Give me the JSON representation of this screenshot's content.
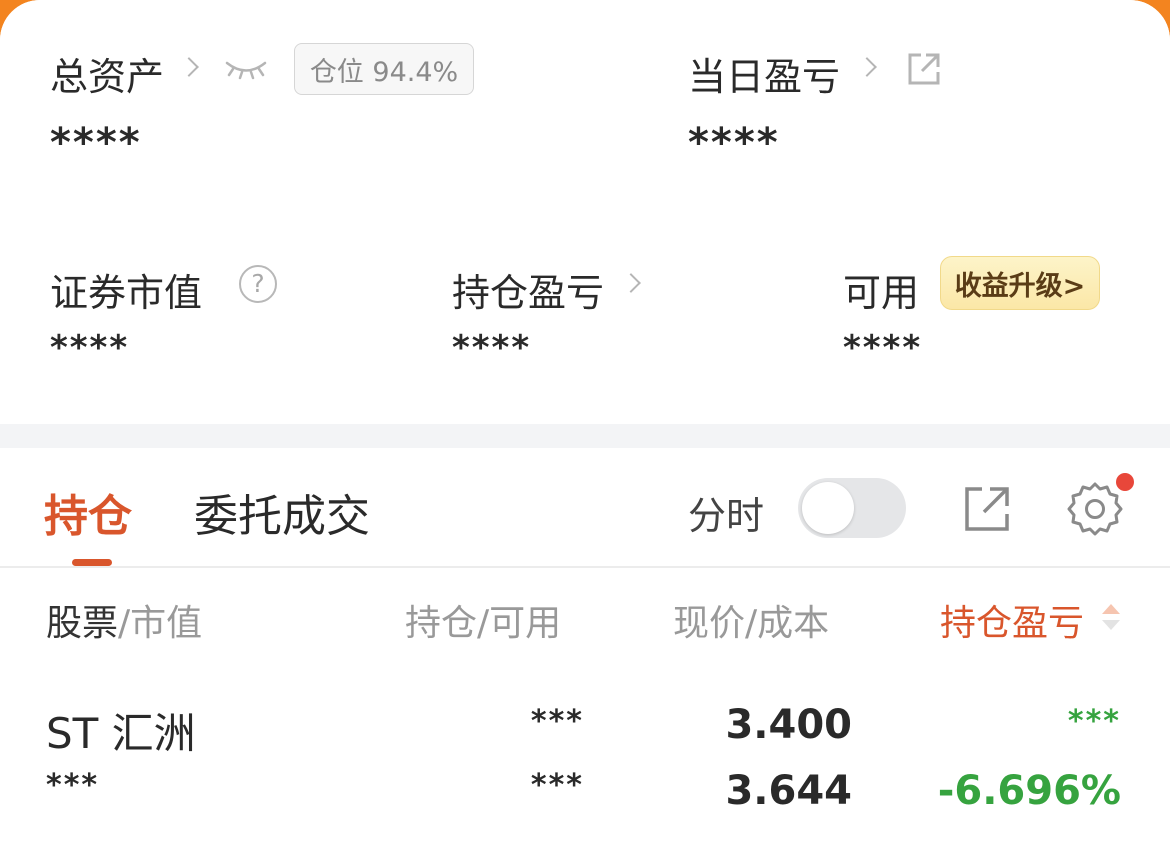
{
  "summary": {
    "total_assets_label": "总资产",
    "position_badge": "仓位 94.4%",
    "total_assets_value": "****",
    "daily_pnl_label": "当日盈亏",
    "daily_pnl_value": "****",
    "market_value_label": "证券市值",
    "market_value_value": "****",
    "help_glyph": "?",
    "holding_pnl_label": "持仓盈亏",
    "holding_pnl_value": "****",
    "available_label": "可用",
    "available_value": "****",
    "upgrade_label": "收益升级>"
  },
  "tabs": {
    "holdings": "持仓",
    "orders": "委托成交",
    "timeshare_label": "分时"
  },
  "columns": {
    "stock": "股票",
    "stock_sub": "/市值",
    "holding": "持仓",
    "holding_sub": "/可用",
    "price": "现价",
    "price_sub": "/成本",
    "pnl": "持仓盈亏"
  },
  "rows": [
    {
      "name": "ST 汇洲",
      "market_value": "***",
      "position": "***",
      "available": "***",
      "price": "3.400",
      "cost": "3.644",
      "pnl": "***",
      "pnl_pct": "-6.696%"
    }
  ],
  "colors": {
    "accent": "#d9562c",
    "frame": "#f3841f",
    "loss_green": "#36a33f",
    "notify_red": "#e8473a"
  },
  "icons": [
    "eye-closed-icon",
    "external-link-icon",
    "help-icon",
    "gear-icon",
    "sort-icon",
    "chevron-right-icon"
  ],
  "toggle_timeshare_on": false
}
